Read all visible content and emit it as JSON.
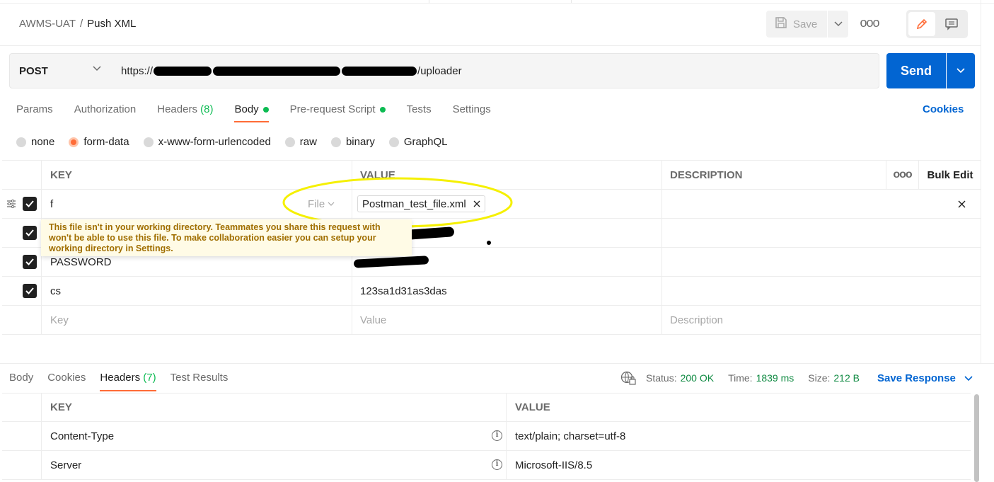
{
  "breadcrumb": {
    "workspace": "AWMS-UAT",
    "separator": "/",
    "request_name": "Push XML"
  },
  "toolbar": {
    "save_label": "Save",
    "more_label": "ooo"
  },
  "request": {
    "method": "POST",
    "url_prefix": "https://",
    "url_suffix": "/uploader",
    "send_label": "Send"
  },
  "request_tabs": [
    {
      "label": "Params"
    },
    {
      "label": "Authorization"
    },
    {
      "label": "Headers",
      "count": "(8)"
    },
    {
      "label": "Body",
      "active": true,
      "has_dot": true
    },
    {
      "label": "Pre-request Script",
      "has_dot": true
    },
    {
      "label": "Tests"
    },
    {
      "label": "Settings"
    }
  ],
  "cookies_label": "Cookies",
  "body_types": [
    "none",
    "form-data",
    "x-www-form-urlencoded",
    "raw",
    "binary",
    "GraphQL"
  ],
  "body_type_selected": "form-data",
  "form_table": {
    "headers": {
      "key": "KEY",
      "value": "VALUE",
      "description": "DESCRIPTION",
      "more": "ooo",
      "bulk_edit": "Bulk Edit"
    },
    "rows": [
      {
        "key": "f",
        "type": "File",
        "value": "Postman_test_file.xml",
        "checked": true
      },
      {
        "key": "",
        "value": "",
        "checked": true
      },
      {
        "key": "PASSWORD",
        "value": "",
        "checked": true
      },
      {
        "key": "cs",
        "value": "123sa1d31as3das",
        "checked": true
      }
    ],
    "placeholders": {
      "key": "Key",
      "value": "Value",
      "description": "Description"
    }
  },
  "warning_tooltip": "This file isn't in your working directory. Teammates you share this request with won't be able to use this file. To make collaboration easier you can setup your working directory in Settings.",
  "response_tabs": [
    {
      "label": "Body"
    },
    {
      "label": "Cookies"
    },
    {
      "label": "Headers",
      "count": "(7)",
      "active": true
    },
    {
      "label": "Test Results"
    }
  ],
  "response_status": {
    "status_label": "Status:",
    "status": "200 OK",
    "time_label": "Time:",
    "time": "1839 ms",
    "size_label": "Size:",
    "size": "212 B"
  },
  "save_response_label": "Save Response",
  "response_headers": {
    "headers": {
      "key": "KEY",
      "value": "VALUE"
    },
    "rows": [
      {
        "key": "Content-Type",
        "value": "text/plain; charset=utf-8"
      },
      {
        "key": "Server",
        "value": "Microsoft-IIS/8.5"
      }
    ]
  },
  "colors": {
    "accent": "#ff6c37",
    "primary": "#0265d2",
    "success": "#0cbb52",
    "highlight": "#f5f000"
  }
}
